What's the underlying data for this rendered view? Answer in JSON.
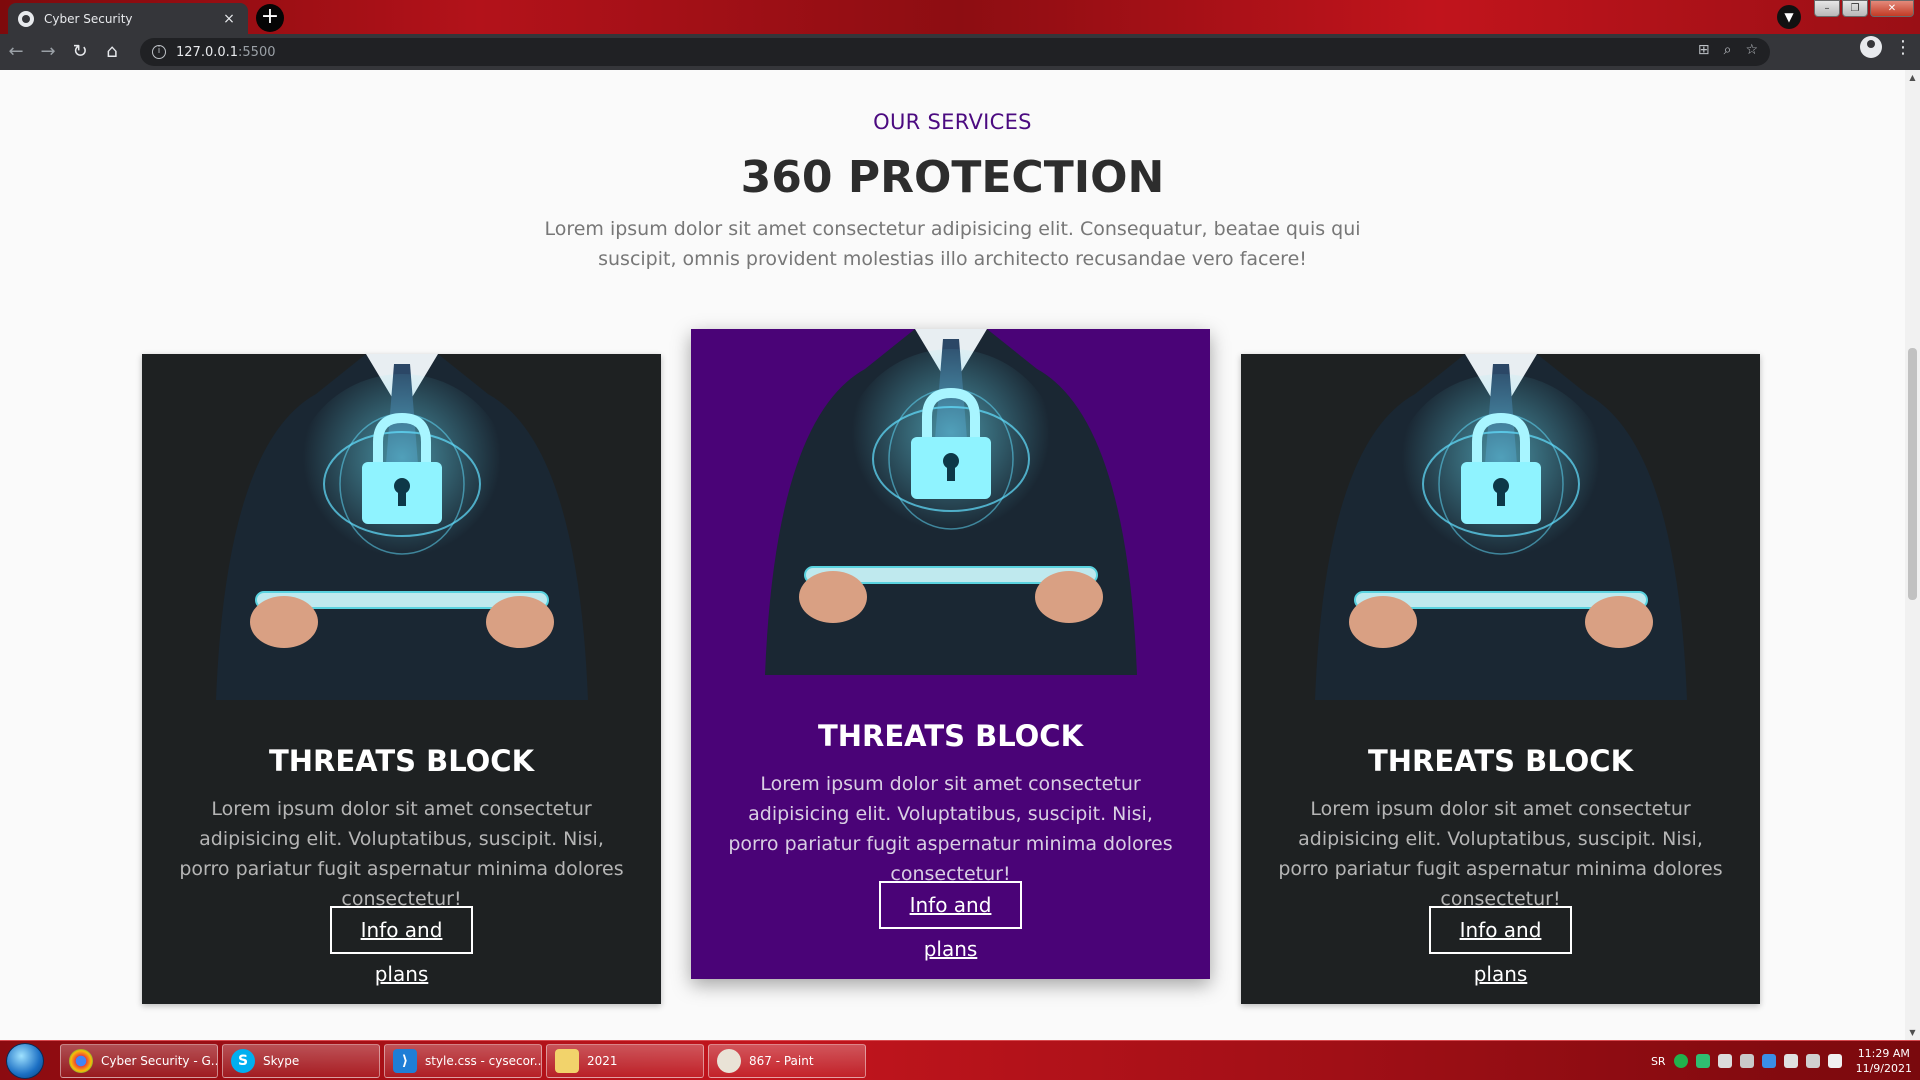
{
  "browser": {
    "tab_title": "Cyber Security",
    "tab_close": "×",
    "new_tab": "+",
    "url_host": "127.0.0.1",
    "url_port": ":5500"
  },
  "page": {
    "eyebrow": "OUR SERVICES",
    "title": "360 PROTECTION",
    "description": "Lorem ipsum dolor sit amet consectetur adipisicing elit. Consequatur, beatae quis qui suscipit, omnis provident molestias illo architecto recusandae vero facere!"
  },
  "cards": [
    {
      "title": "THREATS BLOCK",
      "text": "Lorem ipsum dolor sit amet consectetur adipisicing elit. Voluptatibus, suscipit. Nisi, porro pariatur fugit aspernatur minima dolores consectetur!",
      "button": "Info and plans",
      "background": "#1e2122"
    },
    {
      "title": "THREATS BLOCK",
      "text": "Lorem ipsum dolor sit amet consectetur adipisicing elit. Voluptatibus, suscipit. Nisi, porro pariatur fugit aspernatur minima dolores consectetur!",
      "button": "Info and plans",
      "background": "#4a0377"
    },
    {
      "title": "THREATS BLOCK",
      "text": "Lorem ipsum dolor sit amet consectetur adipisicing elit. Voluptatibus, suscipit. Nisi, porro pariatur fugit aspernatur minima dolores consectetur!",
      "button": "Info and plans",
      "background": "#1e2122"
    }
  ],
  "taskbar": {
    "items": [
      {
        "label": "Cyber Security - G...",
        "icon": "chrome-icon"
      },
      {
        "label": "Skype",
        "icon": "skype-icon"
      },
      {
        "label": "style.css - cysecor...",
        "icon": "vscode-icon"
      },
      {
        "label": "2021",
        "icon": "folder-icon"
      },
      {
        "label": "867 - Paint",
        "icon": "paint-icon"
      }
    ],
    "language": "SR",
    "time": "11:29 AM",
    "date": "11/9/2021"
  },
  "colors": {
    "accent_purple": "#4a0377",
    "eyebrow_purple": "#4b0a80",
    "dark_card": "#1e2122",
    "lock_cyan": "#8ff3ff"
  }
}
